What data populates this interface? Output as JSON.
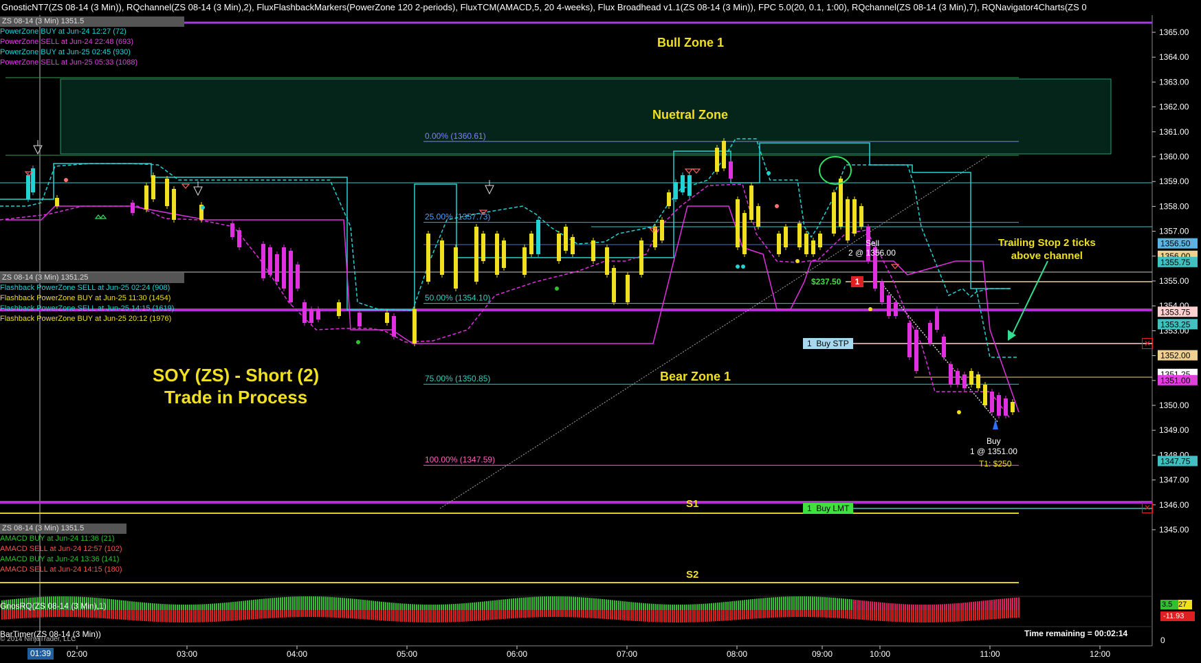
{
  "header": {
    "title": "GnosticNT7(ZS 08-14 (3 Min)), RQchannel(ZS 08-14 (3 Min),2), FluxFlashbackMarkers(PowerZone 120 2-periods), FluxTCM(AMACD,5, 20 4-weeks), Flux Broadhead v1.1(ZS 08-14 (3 Min)), FPC 5.0(20, 0.1, 1:00), RQchannel(ZS 08-14 (3 Min),7), RQNavigator4Charts(ZS 0"
  },
  "powerzone_panel": {
    "head": "ZS 08-14 (3 Min) 1351.5",
    "items": [
      {
        "text": "PowerZone BUY at Jun-24 12:27 (72)",
        "color": "#22d3d3"
      },
      {
        "text": "PowerZone SELL at Jun-24 22:48 (693)",
        "color": "#e040e0"
      },
      {
        "text": "PowerZone BUY at Jun-25 02:45 (930)",
        "color": "#22d3d3"
      },
      {
        "text": "PowerZone SELL at Jun-25 05:33 (1088)",
        "color": "#e040e0"
      }
    ]
  },
  "flashback_panel": {
    "head": "ZS 08-14 (3 Min) 1351.25",
    "items": [
      {
        "text": "Flashback PowerZone SELL at Jun-25 02:24 (908)",
        "color": "#22d3d3"
      },
      {
        "text": "Flashback PowerZone BUY at Jun-25 11:30 (1454)",
        "color": "#f0e020"
      },
      {
        "text": "Flashback PowerZone SELL at Jun-25 14:15 (1619)",
        "color": "#22d3d3"
      },
      {
        "text": "Flashback PowerZone BUY at Jun-25 20:12 (1976)",
        "color": "#f0e020"
      }
    ]
  },
  "amacd_panel": {
    "head": "ZS 08-14 (3 Min) 1351.5",
    "items": [
      {
        "text": "AMACD BUY at Jun-24 11:36 (21)",
        "color": "#30c030"
      },
      {
        "text": "AMACD SELL at Jun-24 12:57 (102)",
        "color": "#ff5050"
      },
      {
        "text": "AMACD BUY at Jun-24 13:36 (141)",
        "color": "#30c030"
      },
      {
        "text": "AMACD SELL at Jun-24 14:15 (180)",
        "color": "#ff5050"
      }
    ]
  },
  "annotations": {
    "bull_zone": "Bull Zone 1",
    "neutral_zone": "Nuetral Zone",
    "bear_zone": "Bear Zone 1",
    "s1": "S1",
    "s2": "S2",
    "trade_line1": "SOY (ZS) - Short (2)",
    "trade_line2": "Trade in Process",
    "trailing_line1": "Trailing Stop 2 ticks",
    "trailing_line2": "above channel",
    "sell_label": "Sell",
    "sell_fill": "2 @ 1356.00",
    "sell_pnl": "$237.50",
    "sell_qty": "1",
    "buy_label": "Buy",
    "buy_fill": "1 @ 1351.00",
    "buy_target": "T1: $250"
  },
  "fib_levels": [
    {
      "label": "0.00% (1360.61)",
      "price": 1360.61,
      "color": "#8080ff"
    },
    {
      "label": "25.00% (1357.73)",
      "price": 1357.36,
      "color": "#4aa0ff"
    },
    {
      "label": "50.00% (1354.10)",
      "price": 1354.1,
      "color": "#30d0c0"
    },
    {
      "label": "75.00% (1350.85)",
      "price": 1350.85,
      "color": "#30d0c0"
    },
    {
      "label": "100.00% (1347.59)",
      "price": 1347.59,
      "color": "#ff60c0"
    }
  ],
  "orders": {
    "buy_stp_qty": "1",
    "buy_stp": "Buy STP",
    "buy_lmt_qty": "1",
    "buy_lmt": "Buy LMT",
    "close_icon": "x-icon"
  },
  "price_tags": [
    {
      "text": "1356.50",
      "price": 1356.5,
      "bg": "#5ab4e0",
      "fg": "#000"
    },
    {
      "text": "1356.00",
      "price": 1356.0,
      "bg": "#f0d090",
      "fg": "#000"
    },
    {
      "text": "1355.75",
      "price": 1355.75,
      "bg": "#40c0c0",
      "fg": "#000"
    },
    {
      "text": "1353.75",
      "price": 1353.75,
      "bg": "#ffd0d0",
      "fg": "#000"
    },
    {
      "text": "1353.25",
      "price": 1353.25,
      "bg": "#40c0c0",
      "fg": "#000"
    },
    {
      "text": "1352.00",
      "price": 1352.0,
      "bg": "#f0d090",
      "fg": "#000"
    },
    {
      "text": "1351.25",
      "price": 1351.25,
      "bg": "#ffffff",
      "fg": "#000"
    },
    {
      "text": "1351.00",
      "price": 1351.0,
      "bg": "#e040e0",
      "fg": "#000"
    },
    {
      "text": "1347.75",
      "price": 1347.75,
      "bg": "#40c0c0",
      "fg": "#000"
    }
  ],
  "price_axis": {
    "ticks": [
      "1365.00",
      "1364.00",
      "1363.00",
      "1362.00",
      "1361.00",
      "1360.00",
      "1359.00",
      "1358.00",
      "1357.00",
      "1356.00",
      "1355.00",
      "1354.00",
      "1353.00",
      "1352.00",
      "1351.00",
      "1350.00",
      "1349.00",
      "1348.00",
      "1347.00",
      "1346.00",
      "1345.00"
    ],
    "values": [
      1365,
      1364,
      1363,
      1362,
      1361,
      1360,
      1359,
      1358,
      1357,
      1356,
      1355,
      1354,
      1353,
      1352,
      1351,
      1350,
      1349,
      1348,
      1347,
      1346,
      1345
    ]
  },
  "time_axis": {
    "current": "01:39",
    "ticks": [
      "02:00",
      "03:00",
      "04:00",
      "05:00",
      "06:00",
      "07:00",
      "08:00",
      "09:00",
      "10:00",
      "11:00",
      "12:00"
    ]
  },
  "gnosrq_panel": {
    "title": "GnosRQ(ZS 08-14 (3 Min),1)",
    "value_pos": "3.5",
    "value_pos2": "27",
    "value_neg": "-11.93"
  },
  "bartimer_panel": {
    "title": "BarTimer(ZS 08-14 (3 Min))",
    "copyright": "© 2014 NinjaTrader, LLC",
    "remaining": "Time remaining = 00:02:14",
    "axis_zero": "0"
  },
  "colors": {
    "bull": "#f0e020",
    "bear": "#e020e0",
    "cyan": "#22d3d3",
    "zone_green": "#1a8a5a",
    "pivot_purple": "#a040e0"
  }
}
